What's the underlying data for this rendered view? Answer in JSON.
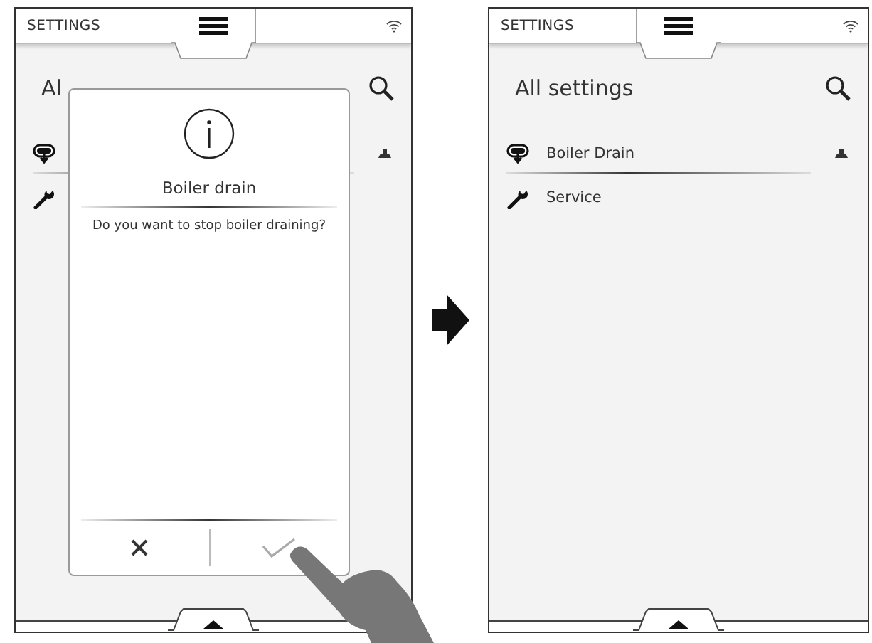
{
  "screens": [
    {
      "header": {
        "title": "SETTINGS"
      },
      "heading": "Al",
      "rows": [
        {
          "kind": "drain"
        },
        {
          "kind": "service"
        }
      ],
      "dialog": {
        "title": "Boiler drain",
        "message": "Do you want to stop boiler draining?",
        "buttons": [
          {
            "kind": "cancel"
          },
          {
            "kind": "confirm",
            "pressed": true
          }
        ]
      }
    },
    {
      "header": {
        "title": "SETTINGS"
      },
      "heading": "All settings",
      "rows": [
        {
          "kind": "drain",
          "label": "Boiler Drain"
        },
        {
          "kind": "service",
          "label": "Service"
        }
      ]
    }
  ]
}
